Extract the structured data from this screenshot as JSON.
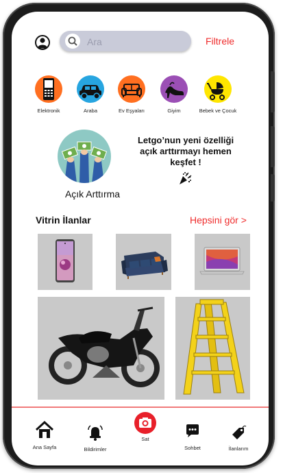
{
  "header": {
    "search_placeholder": "Ara",
    "filter_label": "Filtrele"
  },
  "categories": [
    {
      "label": "Elektronik",
      "icon": "phone-icon",
      "color": "#ff6f20"
    },
    {
      "label": "Araba",
      "icon": "car-icon",
      "color": "#27a5e0"
    },
    {
      "label": "Ev Eşyaları",
      "icon": "sofa-icon",
      "color": "#ff6f20"
    },
    {
      "label": "Giyim",
      "icon": "heel-shoe-icon",
      "color": "#9b4fb5"
    },
    {
      "label": "Bebek ve Çocuk",
      "icon": "stroller-icon",
      "color": "#ffe600"
    }
  ],
  "auction": {
    "title": "Açık Arttırma",
    "promo_line1": "Letgo’nun yeni özelliği",
    "promo_line2": "açık arttırmayı hemen",
    "promo_line3": "keşfet !"
  },
  "featured": {
    "title": "Vitrin İlanlar",
    "see_all": "Hepsini gör  >"
  },
  "bottom_nav": [
    {
      "label": "Ana Sayfa",
      "icon": "home-icon"
    },
    {
      "label": "Bildirimler",
      "icon": "bell-icon"
    },
    {
      "label": "Sat",
      "icon": "camera-icon"
    },
    {
      "label": "Sohbet",
      "icon": "chat-icon"
    },
    {
      "label": "İlanlarım",
      "icon": "tag-icon"
    }
  ],
  "colors": {
    "accent": "#ef2b2b",
    "search_bg": "#c9cbd9",
    "tile_bg": "#c9c9c9"
  }
}
